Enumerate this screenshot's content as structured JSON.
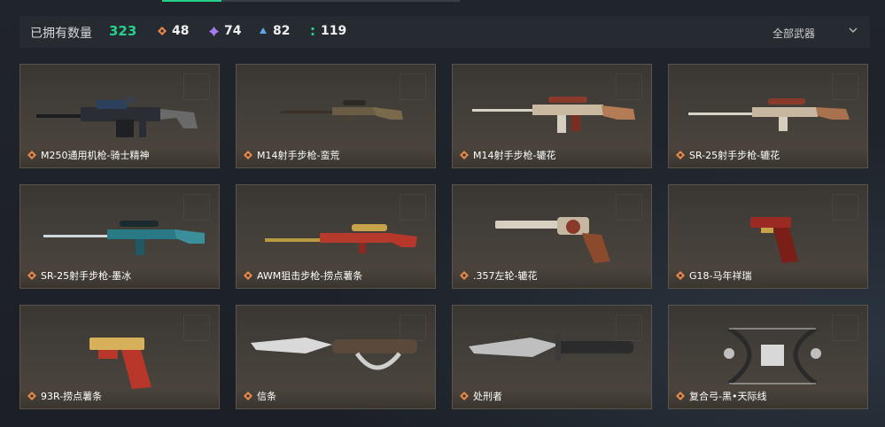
{
  "header": {
    "owned_label": "已拥有数量",
    "owned_count": "323",
    "stats": [
      {
        "icon": "orange-rarity-icon",
        "value": "48",
        "color": "#e8894a"
      },
      {
        "icon": "purple-rarity-icon",
        "value": "74",
        "color": "#a77bf0"
      },
      {
        "icon": "blue-rarity-icon",
        "value": "82",
        "color": "#5fa7e8"
      },
      {
        "icon": "green-rarity-icon",
        "value": "119",
        "color": "#27d08a"
      }
    ],
    "filter_label": "全部武器"
  },
  "accent": "#27d08a",
  "weapons": [
    {
      "name": "M250通用机枪-骑士精神",
      "kind": "rifle-dark"
    },
    {
      "name": "M14射手步枪-蛮荒",
      "kind": "rifle-plain"
    },
    {
      "name": "M14射手步枪-辘花",
      "kind": "rifle-ornate"
    },
    {
      "name": "SR-25射手步枪-辘花",
      "kind": "rifle-ornate"
    },
    {
      "name": "SR-25射手步枪-墨冰",
      "kind": "rifle-ice"
    },
    {
      "name": "AWM狙击步枪-捞点薯条",
      "kind": "sniper-red"
    },
    {
      "name": ".357左轮-辘花",
      "kind": "revolver"
    },
    {
      "name": "G18-马年祥瑞",
      "kind": "pistol-red"
    },
    {
      "name": "93R-捞点薯条",
      "kind": "pistol-gold"
    },
    {
      "name": "信条",
      "kind": "knife-curved"
    },
    {
      "name": "处刑者",
      "kind": "knife-hunter"
    },
    {
      "name": "复合弓-黑•天际线",
      "kind": "bow"
    }
  ]
}
